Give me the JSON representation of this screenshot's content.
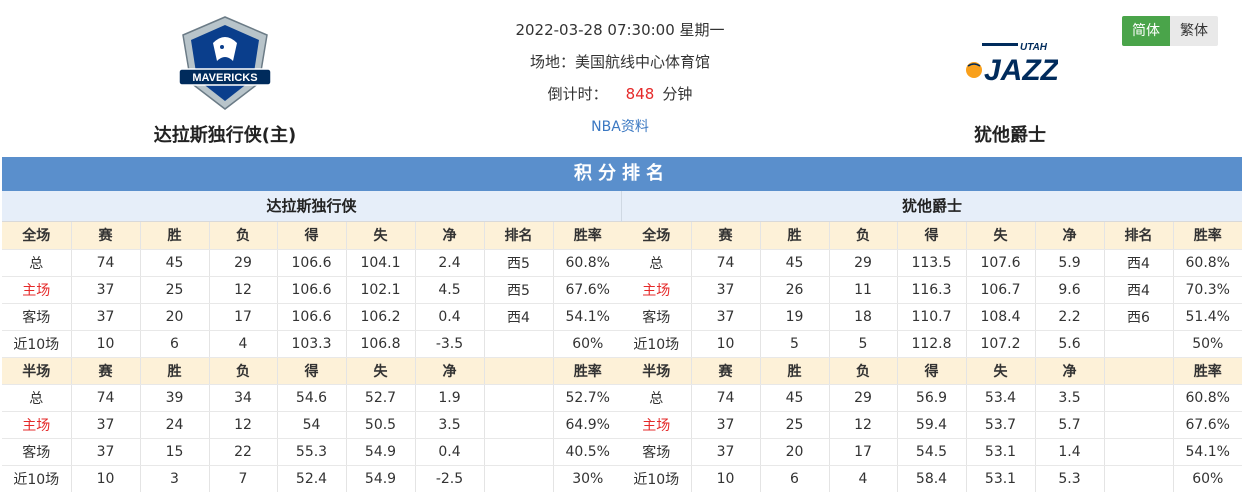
{
  "match": {
    "datetime": "2022-03-28 07:30:00 星期一",
    "venue": "场地：美国航线中心体育馆",
    "countdown_label": "倒计时：",
    "countdown_value": "848",
    "countdown_unit": "分钟",
    "link": "NBA资料"
  },
  "home": {
    "name": "达拉斯独行侠(主)",
    "short_name": "达拉斯独行侠",
    "logo_text": "MAVERICKS",
    "logo_colors": [
      "#0a3e8c",
      "#b8c4ca",
      "#002b5c"
    ]
  },
  "away": {
    "name": "犹他爵士",
    "logo_text": "JAZZ",
    "logo_sub": "UTAH",
    "logo_colors": [
      "#002b5c",
      "#f9a01b",
      "#00471b"
    ]
  },
  "lang": {
    "simplified": "简体",
    "traditional": "繁体"
  },
  "section_title": "积分排名",
  "columns": [
    "赛",
    "胜",
    "负",
    "得",
    "失",
    "净",
    "排名",
    "胜率"
  ],
  "full_label": "全场",
  "half_label": "半场",
  "home_full": [
    [
      "总",
      "74",
      "45",
      "29",
      "106.6",
      "104.1",
      "2.4",
      "西5",
      "60.8%"
    ],
    [
      "主场",
      "37",
      "25",
      "12",
      "106.6",
      "102.1",
      "4.5",
      "西5",
      "67.6%"
    ],
    [
      "客场",
      "37",
      "20",
      "17",
      "106.6",
      "106.2",
      "0.4",
      "西4",
      "54.1%"
    ],
    [
      "近10场",
      "10",
      "6",
      "4",
      "103.3",
      "106.8",
      "-3.5",
      "",
      "60%"
    ]
  ],
  "home_half": [
    [
      "总",
      "74",
      "39",
      "34",
      "54.6",
      "52.7",
      "1.9",
      "",
      "52.7%"
    ],
    [
      "主场",
      "37",
      "24",
      "12",
      "54",
      "50.5",
      "3.5",
      "",
      "64.9%"
    ],
    [
      "客场",
      "37",
      "15",
      "22",
      "55.3",
      "54.9",
      "0.4",
      "",
      "40.5%"
    ],
    [
      "近10场",
      "10",
      "3",
      "7",
      "52.4",
      "54.9",
      "-2.5",
      "",
      "30%"
    ]
  ],
  "away_full": [
    [
      "总",
      "74",
      "45",
      "29",
      "113.5",
      "107.6",
      "5.9",
      "西4",
      "60.8%"
    ],
    [
      "主场",
      "37",
      "26",
      "11",
      "116.3",
      "106.7",
      "9.6",
      "西4",
      "70.3%"
    ],
    [
      "客场",
      "37",
      "19",
      "18",
      "110.7",
      "108.4",
      "2.2",
      "西6",
      "51.4%"
    ],
    [
      "近10场",
      "10",
      "5",
      "5",
      "112.8",
      "107.2",
      "5.6",
      "",
      "50%"
    ]
  ],
  "away_half": [
    [
      "总",
      "74",
      "45",
      "29",
      "56.9",
      "53.4",
      "3.5",
      "",
      "60.8%"
    ],
    [
      "主场",
      "37",
      "25",
      "12",
      "59.4",
      "53.7",
      "5.7",
      "",
      "67.6%"
    ],
    [
      "客场",
      "37",
      "20",
      "17",
      "54.5",
      "53.1",
      "1.4",
      "",
      "54.1%"
    ],
    [
      "近10场",
      "10",
      "6",
      "4",
      "58.4",
      "53.1",
      "5.3",
      "",
      "60%"
    ]
  ]
}
